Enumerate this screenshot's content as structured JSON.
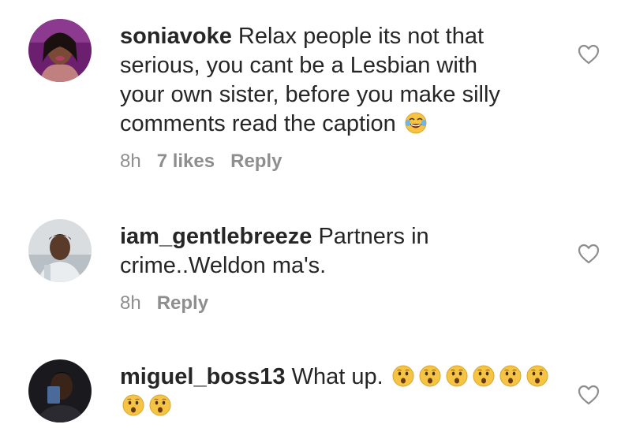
{
  "comments": [
    {
      "username": "soniavoke",
      "text_line1": "Relax people its not that",
      "text_line2": "serious, you cant be a Lesbian with",
      "text_line3": "your own sister, before you make silly",
      "text_line4": "comments read the caption",
      "emoji": "face-with-tears-of-joy-icon",
      "time": "8h",
      "likes": "7 likes",
      "reply_label": "Reply"
    },
    {
      "username": "iam_gentlebreeze",
      "text_line1": "Partners in",
      "text_line2": "crime..Weldon ma's.",
      "time": "8h",
      "reply_label": "Reply"
    },
    {
      "username": "miguel_boss13",
      "text_line1": "What up.",
      "emoji": "hushed-face-icon",
      "emoji_count": 8
    }
  ],
  "colors": {
    "text": "#262626",
    "meta": "#8e8e8e",
    "heart_stroke": "#8e8e8e",
    "emoji_yellow": "#f6c445"
  }
}
